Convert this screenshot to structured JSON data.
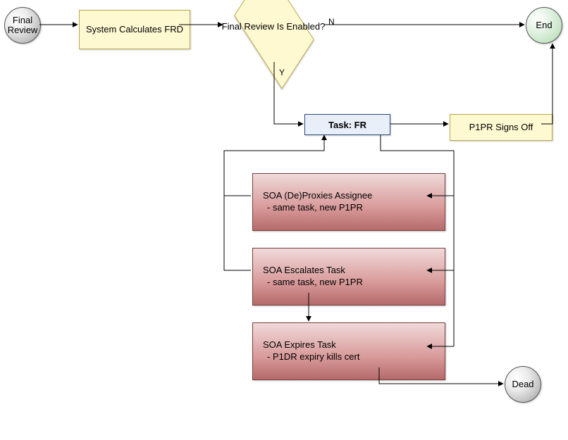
{
  "nodes": {
    "start": {
      "label": "Final\nReview"
    },
    "calc": {
      "label": "System\nCalculates FRD"
    },
    "decision": {
      "label": "Final Review\nIs Enabled?"
    },
    "decision_no": "N",
    "decision_yes": "Y",
    "end": {
      "label": "End"
    },
    "task": {
      "label": "Task: FR"
    },
    "signoff": {
      "label": "P1PR Signs Off"
    },
    "deproxy": {
      "title": "SOA (De)Proxies Assignee",
      "sub": "- same task, new P1PR"
    },
    "escalate": {
      "title": "SOA Escalates Task",
      "sub": "- same task, new P1PR"
    },
    "expire": {
      "title": "SOA Expires Task",
      "sub": "- P1DR expiry kills cert"
    },
    "dead": {
      "label": "Dead"
    }
  },
  "flow": {
    "type": "flowchart",
    "edges": [
      [
        "start",
        "calc"
      ],
      [
        "calc",
        "decision"
      ],
      [
        "decision",
        "end",
        "N"
      ],
      [
        "decision",
        "task",
        "Y"
      ],
      [
        "task",
        "signoff"
      ],
      [
        "signoff",
        "end"
      ],
      [
        "task",
        "deproxy"
      ],
      [
        "deproxy",
        "task"
      ],
      [
        "task",
        "escalate"
      ],
      [
        "escalate",
        "task"
      ],
      [
        "escalate",
        "expire"
      ],
      [
        "task",
        "expire"
      ],
      [
        "expire",
        "dead"
      ]
    ]
  }
}
